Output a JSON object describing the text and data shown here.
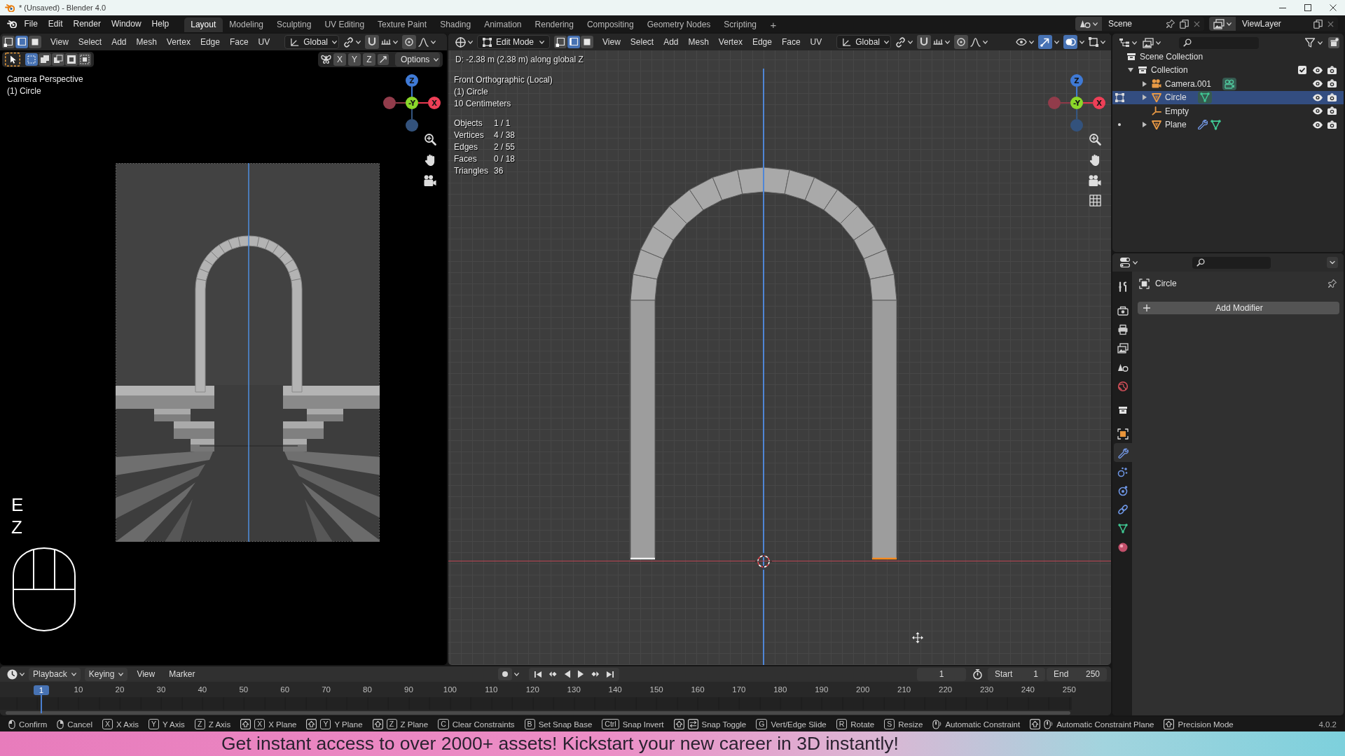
{
  "window": {
    "title": "* (Unsaved) - Blender 4.0"
  },
  "topbar": {
    "menus": [
      "File",
      "Edit",
      "Render",
      "Window",
      "Help"
    ],
    "workspaces": [
      {
        "label": "Layout",
        "selected": true
      },
      {
        "label": "Modeling",
        "selected": false
      },
      {
        "label": "Sculpting",
        "selected": false
      },
      {
        "label": "UV Editing",
        "selected": false
      },
      {
        "label": "Texture Paint",
        "selected": false
      },
      {
        "label": "Shading",
        "selected": false
      },
      {
        "label": "Animation",
        "selected": false
      },
      {
        "label": "Rendering",
        "selected": false
      },
      {
        "label": "Compositing",
        "selected": false
      },
      {
        "label": "Geometry Nodes",
        "selected": false
      },
      {
        "label": "Scripting",
        "selected": false
      }
    ],
    "add_workspace": "+",
    "scene": "Scene",
    "view_layer": "ViewLayer"
  },
  "camera_viewport": {
    "header": {
      "select_modes": [
        {
          "selected": false
        },
        {
          "selected": true
        },
        {
          "selected": false
        }
      ],
      "menus": [
        "View",
        "Select",
        "Add",
        "Mesh",
        "Vertex",
        "Edge",
        "Face",
        "UV"
      ],
      "orientation": "Global",
      "snap": {
        "on": false
      },
      "proportional": {
        "on": false
      }
    },
    "toolbar": {
      "select_box_modes": [
        {
          "selected": true
        },
        {
          "selected": false
        },
        {
          "selected": false
        },
        {
          "selected": false
        },
        {
          "selected": false
        }
      ],
      "mirror_axes": [
        {
          "label": "X",
          "on": false
        },
        {
          "label": "Y",
          "on": false
        },
        {
          "label": "Z",
          "on": false
        }
      ],
      "options": "Options"
    },
    "overlay": [
      "Camera Perspective",
      "(1) Circle"
    ],
    "gizmo": {
      "z": "Z",
      "y": "-Y",
      "x": "X"
    },
    "pressed_keys": [
      "E",
      "Z"
    ]
  },
  "front_viewport": {
    "header": {
      "mode": "Edit Mode",
      "select_modes": [
        {
          "selected": false
        },
        {
          "selected": true
        },
        {
          "selected": false
        }
      ],
      "menus": [
        "View",
        "Select",
        "Add",
        "Mesh",
        "Vertex",
        "Edge",
        "Face",
        "UV"
      ],
      "orientation": "Global",
      "snap": {
        "on": false
      },
      "proportional": {
        "on": false
      },
      "gizmos": {
        "on": true
      },
      "overlays": {
        "on": true
      }
    },
    "operator_info": "D: -2.38 m (2.38 m) along global Z",
    "overlay": [
      "Front Orthographic (Local)",
      "(1) Circle",
      "10 Centimeters"
    ],
    "stats": [
      {
        "label": "Objects",
        "value": "1 / 1"
      },
      {
        "label": "Vertices",
        "value": "4 / 38"
      },
      {
        "label": "Edges",
        "value": "2 / 55"
      },
      {
        "label": "Faces",
        "value": "0 / 18"
      },
      {
        "label": "Triangles",
        "value": "36"
      }
    ],
    "gizmo": {
      "z": "Z",
      "y": "-Y",
      "x": "X"
    }
  },
  "outliner": {
    "root": {
      "label": "Scene Collection",
      "kind": "collection",
      "selected": false,
      "children": [
        {
          "label": "Collection",
          "kind": "collection",
          "expanded": true,
          "checked": true,
          "selected": false,
          "children": [
            {
              "label": "Camera.001",
              "kind": "camera",
              "expanded": false,
              "selected": false,
              "data_active": true
            },
            {
              "label": "Circle",
              "kind": "mesh",
              "expanded": false,
              "selected": true,
              "in_edit_mode": true,
              "data_active": true,
              "modifiers": false
            },
            {
              "label": "Empty",
              "kind": "empty",
              "selected": false
            },
            {
              "label": "Plane",
              "kind": "mesh",
              "expanded": false,
              "selected": false,
              "in_edit_mode": false,
              "data_active": false,
              "modifiers": true
            }
          ]
        }
      ]
    }
  },
  "properties": {
    "tabs": [
      {
        "selected": false
      },
      {
        "selected": false
      },
      {
        "selected": false
      },
      {
        "selected": false
      },
      {
        "selected": false
      },
      {
        "selected": false
      },
      {
        "selected": false
      },
      {
        "selected": false
      },
      {
        "selected": true
      },
      {
        "selected": false
      },
      {
        "selected": false
      },
      {
        "selected": false
      },
      {
        "selected": false
      },
      {
        "selected": false
      }
    ],
    "object_name": "Circle",
    "add_modifier": "Add Modifier"
  },
  "timeline": {
    "menus": [
      {
        "label": "Playback",
        "kind": "dropdown"
      },
      {
        "label": "Keying",
        "kind": "dropdown"
      },
      {
        "label": "View",
        "kind": "menu"
      },
      {
        "label": "Marker",
        "kind": "menu"
      }
    ],
    "frame_marker": "1",
    "ruler": [
      "10",
      "20",
      "30",
      "40",
      "50",
      "60",
      "70",
      "80",
      "90",
      "100",
      "110",
      "120",
      "130",
      "140",
      "150",
      "160",
      "170",
      "180",
      "190",
      "200",
      "210",
      "220",
      "230",
      "240",
      "250"
    ],
    "current_frame": "1",
    "start_label": "Start",
    "start": "1",
    "end_label": "End",
    "end": "250"
  },
  "status_bar": {
    "hints": [
      {
        "keys": [
          {
            "kind": "mouse_left"
          }
        ],
        "label": "Confirm"
      },
      {
        "keys": [
          {
            "kind": "mouse_right"
          }
        ],
        "label": "Cancel"
      },
      {
        "keys": [
          {
            "kind": "key",
            "label": "X"
          }
        ],
        "label": "X Axis"
      },
      {
        "keys": [
          {
            "kind": "key",
            "label": "Y"
          }
        ],
        "label": "Y Axis"
      },
      {
        "keys": [
          {
            "kind": "key",
            "label": "Z"
          }
        ],
        "label": "Z Axis"
      },
      {
        "keys": [
          {
            "kind": "shift"
          },
          {
            "kind": "key",
            "label": "X"
          }
        ],
        "label": "X Plane"
      },
      {
        "keys": [
          {
            "kind": "shift"
          },
          {
            "kind": "key",
            "label": "Y"
          }
        ],
        "label": "Y Plane"
      },
      {
        "keys": [
          {
            "kind": "shift"
          },
          {
            "kind": "key",
            "label": "Z"
          }
        ],
        "label": "Z Plane"
      },
      {
        "keys": [
          {
            "kind": "key",
            "label": "C"
          }
        ],
        "label": "Clear Constraints"
      },
      {
        "keys": [
          {
            "kind": "key",
            "label": "B"
          }
        ],
        "label": "Set Snap Base"
      },
      {
        "keys": [
          {
            "kind": "key",
            "label": "Ctrl"
          }
        ],
        "label": "Snap Invert"
      },
      {
        "keys": [
          {
            "kind": "shift"
          },
          {
            "kind": "tab"
          }
        ],
        "label": "Snap Toggle"
      },
      {
        "keys": [
          {
            "kind": "key",
            "label": "G"
          }
        ],
        "label": "Vert/Edge Slide"
      },
      {
        "keys": [
          {
            "kind": "key",
            "label": "R"
          }
        ],
        "label": "Rotate"
      },
      {
        "keys": [
          {
            "kind": "key",
            "label": "S"
          }
        ],
        "label": "Resize"
      },
      {
        "keys": [
          {
            "kind": "mouse_middle"
          }
        ],
        "label": "Automatic Constraint"
      },
      {
        "keys": [
          {
            "kind": "shift"
          },
          {
            "kind": "mouse_middle"
          }
        ],
        "label": "Automatic Constraint Plane"
      },
      {
        "keys": [
          {
            "kind": "shift"
          }
        ],
        "label": "Precision Mode"
      }
    ],
    "version": "4.0.2"
  },
  "promo_banner": {
    "text": "Get instant access to over 2000+ assets! Kickstart your new career in 3D instantly!"
  }
}
